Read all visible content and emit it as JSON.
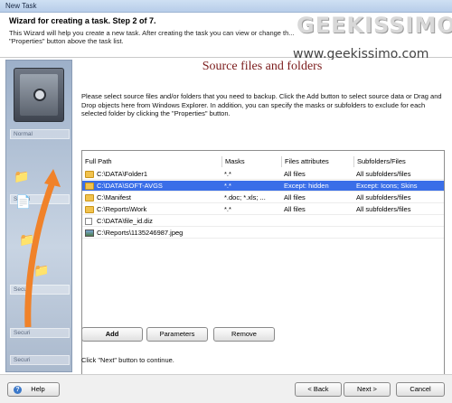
{
  "window": {
    "title": "New Task"
  },
  "header": {
    "title": "Wizard for creating a task. Step 2 of 7.",
    "description": "This Wizard will help you create a new task. After creating the task you can view or change th... \"Properties\" button above the task list."
  },
  "watermark": {
    "logo": "GEEKISSIMO",
    "url": "www.geekissimo.com"
  },
  "left_panel": {
    "ghost_items": [
      "Normal",
      "Securi",
      "Securi",
      "Securi",
      "Securi"
    ],
    "accent_color": "#f0822a"
  },
  "main": {
    "title": "Source files and folders",
    "intro": "Please select source files and/or folders that you need to backup. Click the Add button to select source data or Drag and Drop objects here from Windows Explorer. In addition, you can specify the masks or subfolders to exclude for each selected folder by clicking the \"Properties\" button.",
    "hint": "Click \"Next\" button to continue."
  },
  "table": {
    "columns": [
      "Full Path",
      "Masks",
      "Files attributes",
      "Subfolders/Files"
    ],
    "rows": [
      {
        "icon": "folder-icon",
        "path": "C:\\DATA\\Folder1",
        "masks": "*.*",
        "attributes": "All files",
        "subfolders": "All subfolders/files",
        "selected": false
      },
      {
        "icon": "folder-icon",
        "path": "C:\\DATA\\SOFT-AVGS",
        "masks": "*.*",
        "attributes": "Except: hidden",
        "subfolders": "Except: Icons; Skins",
        "selected": true
      },
      {
        "icon": "folder-icon",
        "path": "C:\\Manifest",
        "masks": "*.doc; *.xls; ...",
        "attributes": "All files",
        "subfolders": "All subfolders/files",
        "selected": false
      },
      {
        "icon": "folder-icon",
        "path": "C:\\Reports\\Work",
        "masks": "*.*",
        "attributes": "All files",
        "subfolders": "All subfolders/files",
        "selected": false
      },
      {
        "icon": "file-icon",
        "path": "C:\\DATA\\file_id.diz",
        "masks": "",
        "attributes": "",
        "subfolders": "",
        "selected": false
      },
      {
        "icon": "image-icon",
        "path": "C:\\Reports\\1135246987.jpeg",
        "masks": "",
        "attributes": "",
        "subfolders": "",
        "selected": false
      }
    ],
    "selection_color": "#3a6ee8"
  },
  "actions": {
    "add": "Add",
    "parameters": "Parameters",
    "remove": "Remove"
  },
  "footer": {
    "help": "Help",
    "back": "< Back",
    "next": "Next >",
    "cancel": "Cancel"
  }
}
